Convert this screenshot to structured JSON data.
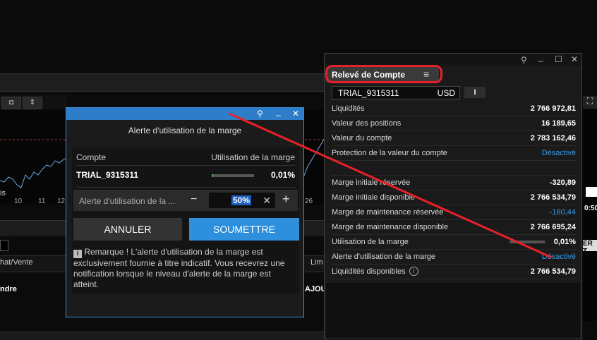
{
  "background": {
    "x_ticks": [
      "10",
      "11",
      "12",
      "26"
    ],
    "axis_label": "is",
    "col_labels": [
      "hat/Vente",
      "Lim"
    ],
    "row_labels": [
      "ndre",
      "AJOU"
    ],
    "right_label": "ER T",
    "right_time": "0:50"
  },
  "dialog": {
    "title": "Alerte d'utilisation de la marge",
    "col_account": "Compte",
    "col_usage": "Utilisation de la marge",
    "account": "TRIAL_9315311",
    "usage": "0,01%",
    "usage_fraction": 0.0001,
    "alert_label": "Alerte d'utilisation de la ...",
    "alert_value": "50%",
    "minus": "−",
    "plus": "+",
    "clear": "✕",
    "cancel_label": "ANNULER",
    "submit_label": "SOUMETTRE",
    "remark": "Remarque ! L'alerte d'utilisation de la marge est exclusivement fournie à titre indicatif. Vous recevrez une notification lorsque le niveau d'alerte de la marge est atteint."
  },
  "panel": {
    "tab_title": "Relevé de Compte",
    "account": "TRIAL_9315311",
    "currency": "USD",
    "rows": [
      {
        "label": "Liquidités",
        "value": "2 766 972,81"
      },
      {
        "label": "Valeur des positions",
        "value": "16 189,65"
      },
      {
        "label": "Valeur du compte",
        "value": "2 783 162,46"
      },
      {
        "label": "Protection de la valeur du compte",
        "value": "Désactivé"
      },
      {
        "label": "Marge initiale réservée",
        "value": "-320,89"
      },
      {
        "label": "Marge initiale disponible",
        "value": "2 766 534,79"
      },
      {
        "label": "Marge de maintenance réservée",
        "value": "-160,44"
      },
      {
        "label": "Marge de maintenance disponible",
        "value": "2 766 695,24"
      },
      {
        "label": "Utilisation de la marge",
        "value": "0,01%"
      },
      {
        "label": "Alerte d'utilisation de la marge",
        "value": "Désactivé"
      },
      {
        "label": "Liquidités disponibles",
        "value": "2 766 534,79"
      }
    ]
  },
  "colors": {
    "accent": "#3b9be8",
    "annotation": "#e8202a",
    "titlebar": "#2e7dc8"
  }
}
